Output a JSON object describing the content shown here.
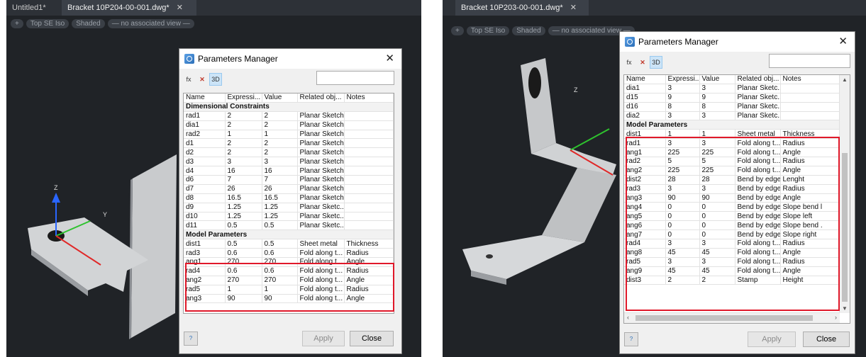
{
  "left": {
    "tabs": [
      {
        "label": "Untitled1*",
        "active": false
      },
      {
        "label": "Bracket 10P204-00-001.dwg*",
        "active": true
      }
    ],
    "tab_close": "✕",
    "view_buttons": [
      "+",
      "Top SE Iso",
      "Shaded",
      "— no associated view —"
    ],
    "axis_labels": {
      "z": "Z",
      "y": "Y"
    },
    "dialog": {
      "title": "Parameters Manager",
      "close": "✕",
      "toolbar": {
        "add": "fx",
        "delete": "✕",
        "view3d": "3D"
      },
      "columns": [
        "Name",
        "Expressi...",
        "Value",
        "Related obj...",
        "Notes"
      ],
      "rows": [
        {
          "group": "Dimensional Constraints"
        },
        {
          "c": [
            "rad1",
            "2",
            "2",
            "Planar Sketch",
            ""
          ]
        },
        {
          "c": [
            "dia1",
            "2",
            "2",
            "Planar Sketch",
            ""
          ]
        },
        {
          "c": [
            "rad2",
            "1",
            "1",
            "Planar Sketch",
            ""
          ]
        },
        {
          "c": [
            "d1",
            "2",
            "2",
            "Planar Sketch",
            ""
          ]
        },
        {
          "c": [
            "d2",
            "2",
            "2",
            "Planar Sketch",
            ""
          ]
        },
        {
          "c": [
            "d3",
            "3",
            "3",
            "Planar Sketch",
            ""
          ]
        },
        {
          "c": [
            "d4",
            "16",
            "16",
            "Planar Sketch",
            ""
          ]
        },
        {
          "c": [
            "d6",
            "7",
            "7",
            "Planar Sketch",
            ""
          ]
        },
        {
          "c": [
            "d7",
            "26",
            "26",
            "Planar Sketch",
            ""
          ]
        },
        {
          "c": [
            "d8",
            "16.5",
            "16.5",
            "Planar Sketch",
            ""
          ]
        },
        {
          "c": [
            "d9",
            "1.25",
            "1.25",
            "Planar Sketc...",
            ""
          ]
        },
        {
          "c": [
            "d10",
            "1.25",
            "1.25",
            "Planar Sketc...",
            ""
          ]
        },
        {
          "c": [
            "d11",
            "0.5",
            "0.5",
            "Planar Sketc...",
            ""
          ]
        },
        {
          "group": "Model Parameters"
        },
        {
          "c": [
            "dist1",
            "0.5",
            "0.5",
            "Sheet metal",
            "Thickness"
          ]
        },
        {
          "c": [
            "rad3",
            "0.6",
            "0.6",
            "Fold along t...",
            "Radius"
          ]
        },
        {
          "c": [
            "ang1",
            "270",
            "270",
            "Fold along t...",
            "Angle"
          ]
        },
        {
          "c": [
            "rad4",
            "0.6",
            "0.6",
            "Fold along t...",
            "Radius"
          ]
        },
        {
          "c": [
            "ang2",
            "270",
            "270",
            "Fold along t...",
            "Angle"
          ]
        },
        {
          "c": [
            "rad5",
            "1",
            "1",
            "Fold along t...",
            "Radius"
          ]
        },
        {
          "c": [
            "ang3",
            "90",
            "90",
            "Fold along t...",
            "Angle"
          ]
        }
      ],
      "apply": "Apply",
      "close_button": "Close",
      "help": "?"
    }
  },
  "right": {
    "tabs": [
      {
        "label": "Bracket 10P203-00-001.dwg*",
        "active": true
      }
    ],
    "tab_close": "✕",
    "view_buttons": [
      "+",
      "Top SE Iso",
      "Shaded",
      "— no associated view —"
    ],
    "axis_labels": {
      "z": "Z"
    },
    "dialog": {
      "title": "Parameters Manager",
      "close": "✕",
      "toolbar": {
        "add": "fx",
        "delete": "✕",
        "view3d": "3D"
      },
      "columns": [
        "Name",
        "Expressi...",
        "Value",
        "Related obj...",
        "Notes"
      ],
      "rows": [
        {
          "c": [
            "dia1",
            "3",
            "3",
            "Planar Sketc...",
            ""
          ]
        },
        {
          "c": [
            "d15",
            "9",
            "9",
            "Planar Sketc...",
            ""
          ]
        },
        {
          "c": [
            "d16",
            "8",
            "8",
            "Planar Sketc...",
            ""
          ]
        },
        {
          "c": [
            "dia2",
            "3",
            "3",
            "Planar Sketc...",
            ""
          ]
        },
        {
          "group": "Model Parameters"
        },
        {
          "c": [
            "dist1",
            "1",
            "1",
            "Sheet metal",
            "Thickness"
          ]
        },
        {
          "c": [
            "rad1",
            "3",
            "3",
            "Fold along t...",
            "Radius"
          ]
        },
        {
          "c": [
            "ang1",
            "225",
            "225",
            "Fold along t...",
            "Angle"
          ]
        },
        {
          "c": [
            "rad2",
            "5",
            "5",
            "Fold along t...",
            "Radius"
          ]
        },
        {
          "c": [
            "ang2",
            "225",
            "225",
            "Fold along t...",
            "Angle"
          ]
        },
        {
          "c": [
            "dist2",
            "28",
            "28",
            "Bend by edge",
            "Lenght"
          ]
        },
        {
          "c": [
            "rad3",
            "3",
            "3",
            "Bend by edge",
            "Radius"
          ]
        },
        {
          "c": [
            "ang3",
            "90",
            "90",
            "Bend by edge",
            "Angle"
          ]
        },
        {
          "c": [
            "ang4",
            "0",
            "0",
            "Bend by edge",
            "Slope bend l"
          ]
        },
        {
          "c": [
            "ang5",
            "0",
            "0",
            "Bend by edge",
            "Slope left"
          ]
        },
        {
          "c": [
            "ang6",
            "0",
            "0",
            "Bend by edge",
            "Slope bend ."
          ]
        },
        {
          "c": [
            "ang7",
            "0",
            "0",
            "Bend by edge",
            "Slope right"
          ]
        },
        {
          "c": [
            "rad4",
            "3",
            "3",
            "Fold along t...",
            "Radius"
          ]
        },
        {
          "c": [
            "ang8",
            "45",
            "45",
            "Fold along t...",
            "Angle"
          ]
        },
        {
          "c": [
            "rad5",
            "3",
            "3",
            "Fold along t...",
            "Radius"
          ]
        },
        {
          "c": [
            "ang9",
            "45",
            "45",
            "Fold along t...",
            "Angle"
          ]
        },
        {
          "c": [
            "dist3",
            "2",
            "2",
            "Stamp",
            "Height"
          ]
        }
      ],
      "scroll": {
        "up": "▲",
        "down": "▼",
        "left": "‹",
        "right": "›"
      },
      "apply": "Apply",
      "close_button": "Close",
      "help": "?"
    }
  }
}
